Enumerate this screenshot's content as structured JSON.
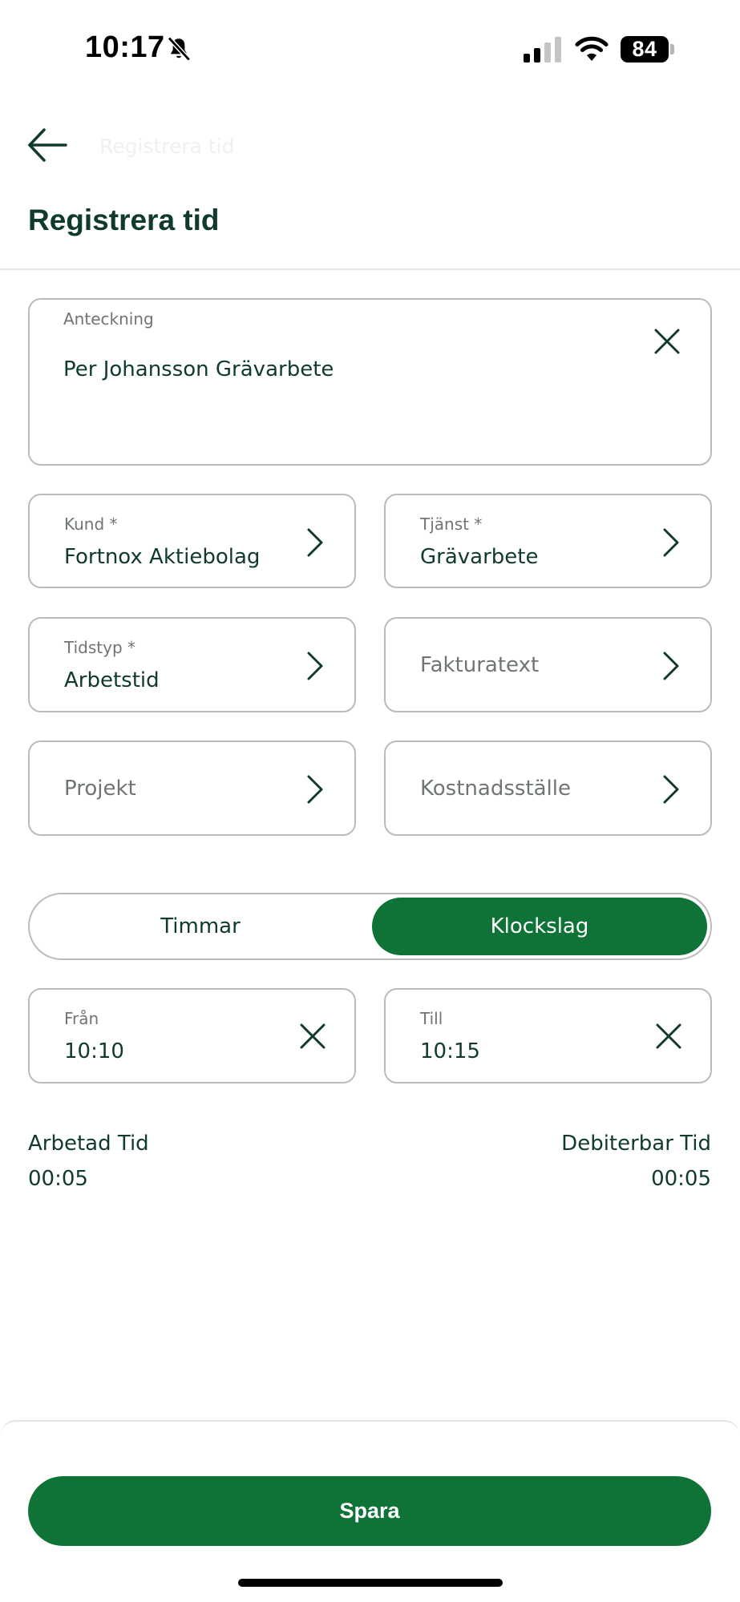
{
  "status_bar": {
    "time": "10:17",
    "battery": "84",
    "icons": [
      "bell-slash-icon",
      "cellular-signal-icon",
      "wifi-icon",
      "battery-icon"
    ]
  },
  "nav": {
    "back_icon": "arrow-left-icon",
    "title": "Registrera tid"
  },
  "page_title": "Registrera tid",
  "note": {
    "label": "Anteckning",
    "value": "Per Johansson Grävarbete",
    "clear_icon": "close-icon"
  },
  "fields": {
    "kund": {
      "label": "Kund *",
      "value": "Fortnox Aktiebolag"
    },
    "tjanst": {
      "label": "Tjänst *",
      "value": "Grävarbete"
    },
    "tidstyp": {
      "label": "Tidstyp *",
      "value": "Arbetstid"
    },
    "fakturatext": {
      "placeholder": "Fakturatext"
    },
    "projekt": {
      "placeholder": "Projekt"
    },
    "kostnadsstalle": {
      "placeholder": "Kostnadsställe"
    }
  },
  "mode_toggle": {
    "options": [
      "Timmar",
      "Klockslag"
    ],
    "selected": "Klockslag"
  },
  "time_range": {
    "from": {
      "label": "Från",
      "value": "10:10"
    },
    "to": {
      "label": "Till",
      "value": "10:15"
    }
  },
  "summary": {
    "worked": {
      "label": "Arbetad Tid",
      "value": "00:05"
    },
    "billable": {
      "label": "Debiterbar Tid",
      "value": "00:05"
    }
  },
  "save_label": "Spara",
  "colors": {
    "primary": "#0f7338",
    "text_dark": "#103b2b",
    "text_muted": "#6f7573",
    "border": "#b8bcbb"
  }
}
